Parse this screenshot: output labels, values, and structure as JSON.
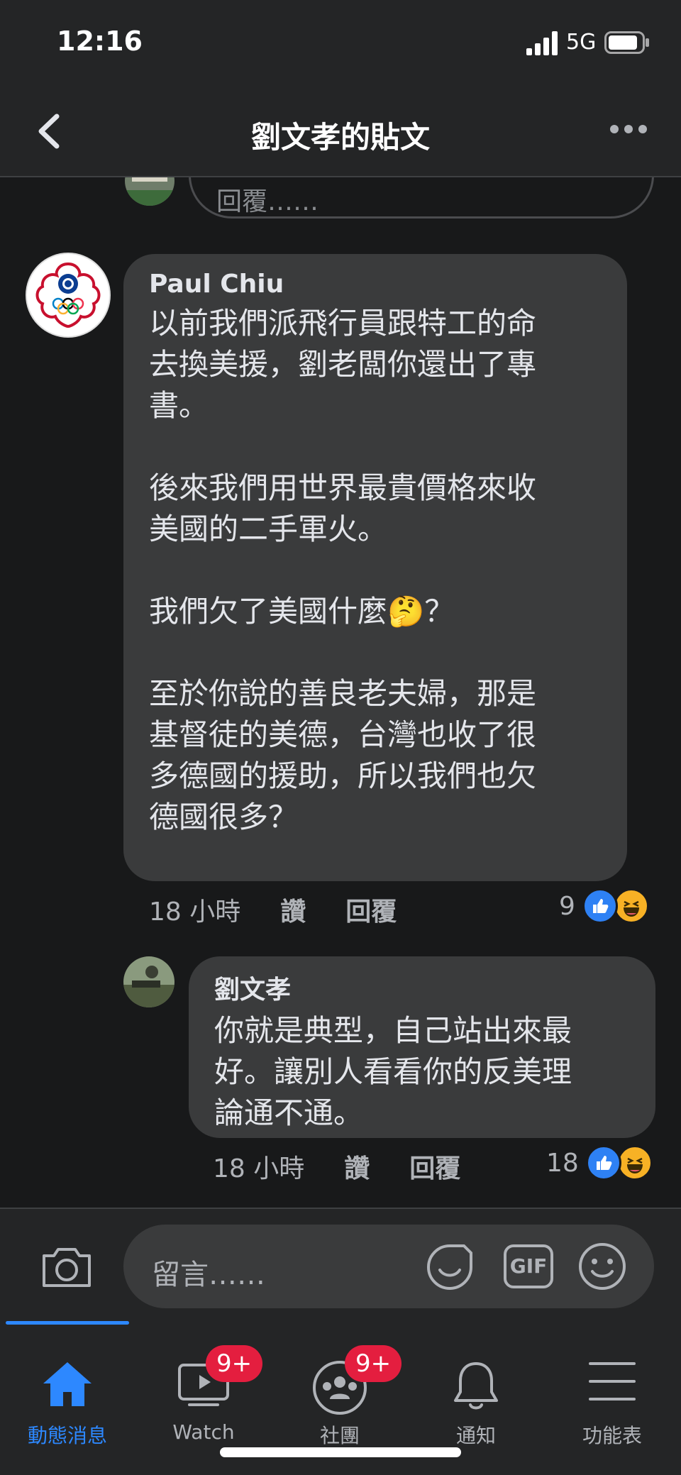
{
  "status": {
    "time": "12:16",
    "network": "5G"
  },
  "nav": {
    "title": "劉文孝的貼文"
  },
  "prev_reply": {
    "placeholder": "回覆……"
  },
  "comments": [
    {
      "author": "Paul Chiu",
      "text": "以前我們派飛行員跟特工的命\n去換美援，劉老闆你還出了專\n書。\n\n後來我們用世界最貴價格來收\n美國的二手軍火。\n\n我們欠了美國什麼🤔？\n\n至於你說的善良老夫婦，那是\n基督徒的美德，台灣也收了很\n多德國的援助，所以我們也欠\n德國很多？",
      "time": "18 小時",
      "like": "讚",
      "reply": "回覆",
      "reaction_count": "9"
    },
    {
      "author": "劉文孝",
      "text": "你就是典型，自己站出來最\n好。讓別人看看你的反美理\n論通不通。",
      "time": "18 小時",
      "like": "讚",
      "reply": "回覆",
      "reaction_count": "18"
    }
  ],
  "composer": {
    "placeholder": "留言……",
    "gif_label": "GIF"
  },
  "tabs": [
    {
      "label": "動態消息",
      "icon": "home-icon",
      "active": true
    },
    {
      "label": "Watch",
      "icon": "watch-icon",
      "badge": "9+"
    },
    {
      "label": "社團",
      "icon": "groups-icon",
      "badge": "9+"
    },
    {
      "label": "通知",
      "icon": "bell-icon"
    },
    {
      "label": "功能表",
      "icon": "menu-icon"
    }
  ],
  "colors": {
    "accent": "#2d88ff",
    "bubble": "#3a3b3c",
    "badge": "#e41e3f",
    "like": "#2e81f4",
    "haha": "#f7b125"
  }
}
